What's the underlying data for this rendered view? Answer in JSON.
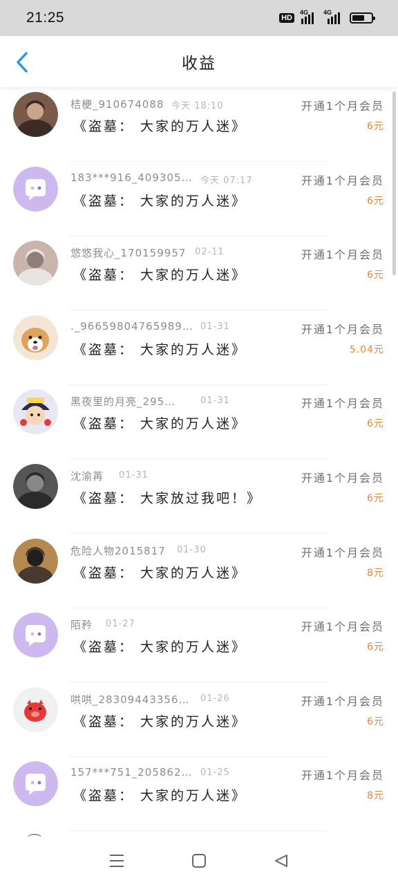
{
  "status_bar": {
    "time": "21:25",
    "hd_label": "HD",
    "network_1": "4G",
    "network_2": "4G",
    "battery_level": 0.65
  },
  "header": {
    "title": "收益",
    "back_icon": "chevron-left-icon",
    "accent_color": "#2196f3"
  },
  "list": {
    "amount_color": "#e8833a",
    "rows": [
      {
        "name": "桔梗_910674088",
        "time": "今天 18:10",
        "action": "开通1个月会员",
        "title": "《盗墓： 大家的万人迷》",
        "amount": "6元",
        "avatar": "photo-avatar"
      },
      {
        "name": "183***916_409305…",
        "time": "今天 07:17",
        "action": "开通1个月会员",
        "title": "《盗墓： 大家的万人迷》",
        "amount": "6元",
        "avatar": "default-avatar"
      },
      {
        "name": "悠悠我心_170159957",
        "time": "02-11",
        "action": "开通1个月会员",
        "title": "《盗墓： 大家的万人迷》",
        "amount": "6元",
        "avatar": "photo-avatar"
      },
      {
        "name": "._966598047659​89…",
        "time": "01-31",
        "action": "开通1个月会员",
        "title": "《盗墓： 大家的万人迷》",
        "amount": "5.04元",
        "avatar": "dog-avatar"
      },
      {
        "name": "黑夜里的月亮_295…",
        "time": "01-31",
        "action": "开通1个月会员",
        "title": "《盗墓： 大家的万人迷》",
        "amount": "6元",
        "avatar": "cartoon-avatar"
      },
      {
        "name": "沈渝苒",
        "time": "01-31",
        "action": "开通1个月会员",
        "title": "《盗墓： 大家放过我吧！》",
        "amount": "6元",
        "avatar": "photo-avatar"
      },
      {
        "name": "危险人物2015817",
        "time": "01-30",
        "action": "开通1个月会员",
        "title": "《盗墓： 大家的万人迷》",
        "amount": "8元",
        "avatar": "photo-avatar"
      },
      {
        "name": "陌矜",
        "time": "01-27",
        "action": "开通1个月会员",
        "title": "《盗墓： 大家的万人迷》",
        "amount": "6元",
        "avatar": "default-avatar"
      },
      {
        "name": "哄哄_28309443356…",
        "time": "01-26",
        "action": "开通1个月会员",
        "title": "《盗墓： 大家的万人迷》",
        "amount": "6元",
        "avatar": "pig-avatar"
      },
      {
        "name": "157***751_205862…",
        "time": "01-25",
        "action": "开通1个月会员",
        "title": "《盗墓： 大家的万人迷》",
        "amount": "8元",
        "avatar": "default-avatar"
      }
    ]
  },
  "bottom_nav": {
    "menu_icon": "menu-icon",
    "home_icon": "home-square-icon",
    "back_icon": "back-triangle-icon"
  }
}
